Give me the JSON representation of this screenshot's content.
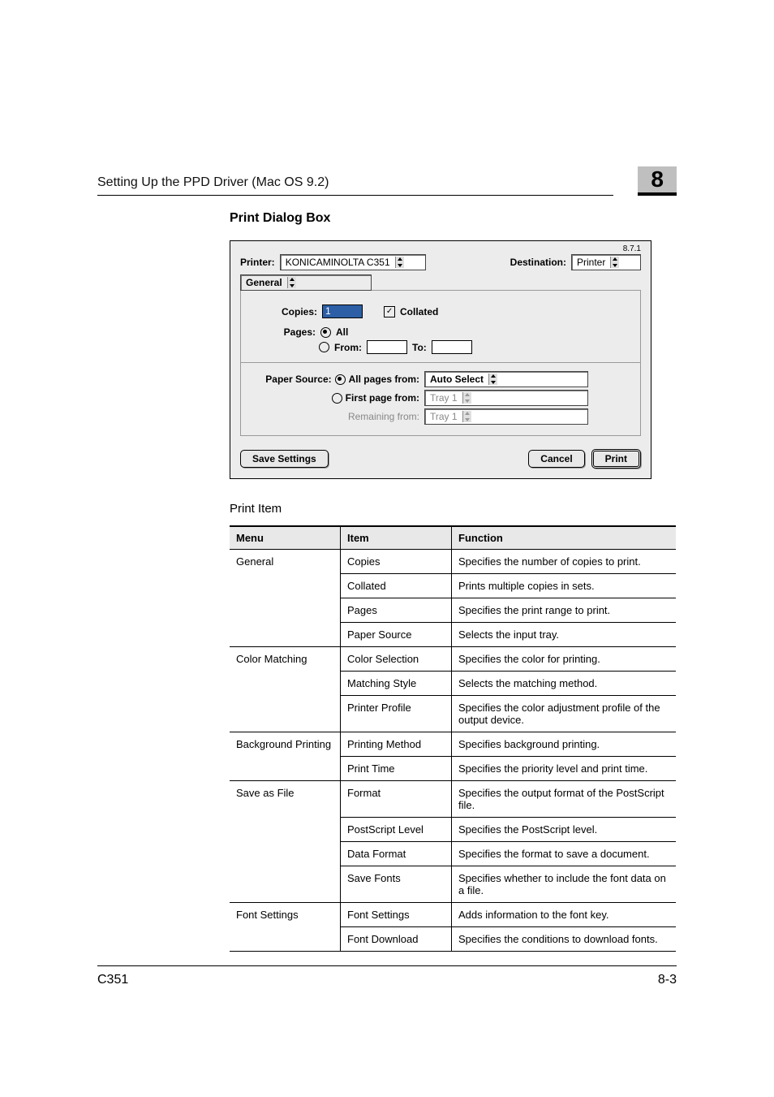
{
  "header": {
    "title": "Setting Up the PPD Driver (Mac OS 9.2)",
    "chapter": "8"
  },
  "section": {
    "title": "Print Dialog Box"
  },
  "dialog": {
    "version": "8.7.1",
    "printer_label": "Printer:",
    "printer_value": "KONICAMINOLTA C351",
    "destination_label": "Destination:",
    "destination_value": "Printer",
    "panel_value": "General",
    "copies_label": "Copies:",
    "copies_value": "1",
    "collated_label": "Collated",
    "collated_check": "✓",
    "pages_label": "Pages:",
    "pages_all": "All",
    "pages_from": "From:",
    "pages_to": "To:",
    "papersource_label": "Paper Source:",
    "ps_allpages": "All pages from:",
    "ps_allpages_value": "Auto Select",
    "ps_firstpage": "First page from:",
    "ps_firstpage_value": "Tray 1",
    "ps_remaining": "Remaining from:",
    "ps_remaining_value": "Tray 1",
    "btn_save": "Save Settings",
    "btn_cancel": "Cancel",
    "btn_print": "Print"
  },
  "table": {
    "caption": "Print Item",
    "headers": {
      "menu": "Menu",
      "item": "Item",
      "function": "Function"
    },
    "rows": [
      {
        "menu": "General",
        "item": "Copies",
        "function": "Specifies the number of copies to print."
      },
      {
        "menu": "",
        "item": "Collated",
        "function": "Prints multiple copies in sets."
      },
      {
        "menu": "",
        "item": "Pages",
        "function": "Specifies the print range to print."
      },
      {
        "menu": "",
        "item": "Paper Source",
        "function": "Selects the input tray."
      },
      {
        "menu": "Color Matching",
        "item": "Color Selection",
        "function": "Specifies the color for printing."
      },
      {
        "menu": "",
        "item": "Matching Style",
        "function": "Selects the matching method."
      },
      {
        "menu": "",
        "item": "Printer Profile",
        "function": "Specifies the color adjustment profile of the output device."
      },
      {
        "menu": "Background Printing",
        "item": "Printing Method",
        "function": "Specifies background printing."
      },
      {
        "menu": "",
        "item": "Print Time",
        "function": "Specifies the priority level and print time."
      },
      {
        "menu": "Save as File",
        "item": "Format",
        "function": "Specifies the output format of the PostScript file."
      },
      {
        "menu": "",
        "item": "PostScript Level",
        "function": "Specifies the PostScript level."
      },
      {
        "menu": "",
        "item": "Data Format",
        "function": "Specifies the format to save a document."
      },
      {
        "menu": "",
        "item": "Save Fonts",
        "function": "Specifies whether to include the font data on a file."
      },
      {
        "menu": "Font Settings",
        "item": "Font Settings",
        "function": "Adds information to the font key."
      },
      {
        "menu": "",
        "item": "Font Download",
        "function": "Specifies the conditions to download fonts."
      }
    ]
  },
  "footer": {
    "model": "C351",
    "page": "8-3"
  }
}
